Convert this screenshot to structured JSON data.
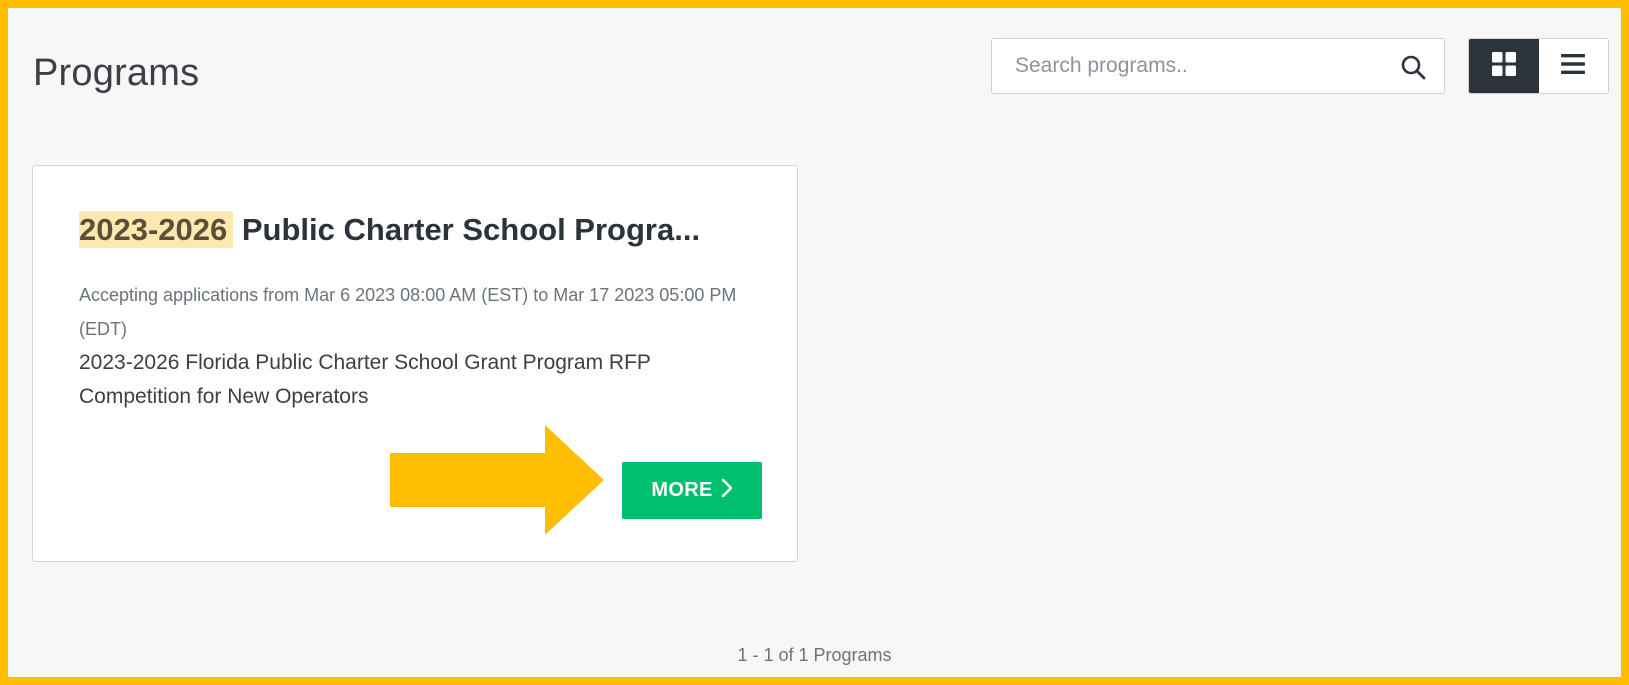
{
  "page": {
    "title": "Programs"
  },
  "search": {
    "placeholder": "Search programs.."
  },
  "view_toggle": {
    "active": "grid"
  },
  "program_card": {
    "title_highlight": "2023-2026",
    "title_rest": " Public Charter School Progra...",
    "meta": "Accepting applications from Mar 6 2023 08:00 AM (EST) to Mar 17 2023 05:00 PM (EDT)",
    "description": "2023-2026 Florida Public Charter School Grant Program RFP Competition for New Operators",
    "more_label": "MORE"
  },
  "pagination": {
    "summary": "1 - 1 of 1 Programs"
  },
  "colors": {
    "frame_border": "#ffbf00",
    "primary_button": "#00bf6f",
    "toggle_active": "#2d333b",
    "highlight": "#fde8b0"
  },
  "icons": [
    "search-icon",
    "grid-view-icon",
    "list-view-icon",
    "chevron-right-icon",
    "annotation-arrow-icon"
  ]
}
